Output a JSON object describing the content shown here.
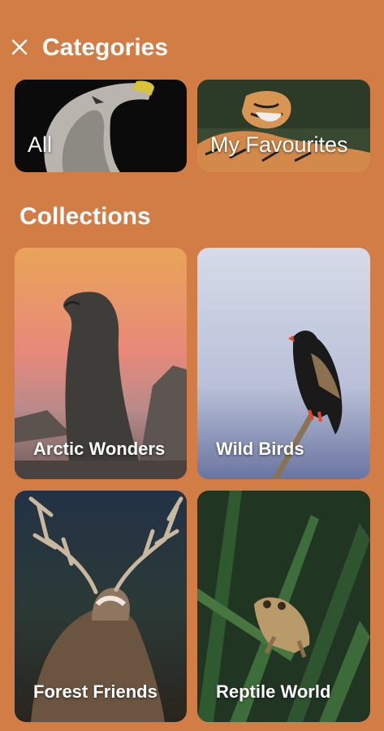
{
  "header": {
    "title": "Categories",
    "close_icon": "close-icon"
  },
  "categories": [
    {
      "label": "All"
    },
    {
      "label": "My Favourites"
    }
  ],
  "collections_title": "Collections",
  "collections": [
    {
      "label": "Arctic Wonders"
    },
    {
      "label": "Wild Birds"
    },
    {
      "label": "Forest Friends"
    },
    {
      "label": "Reptile World"
    }
  ],
  "colors": {
    "background": "#D27C46",
    "text": "#FFFFFF"
  }
}
